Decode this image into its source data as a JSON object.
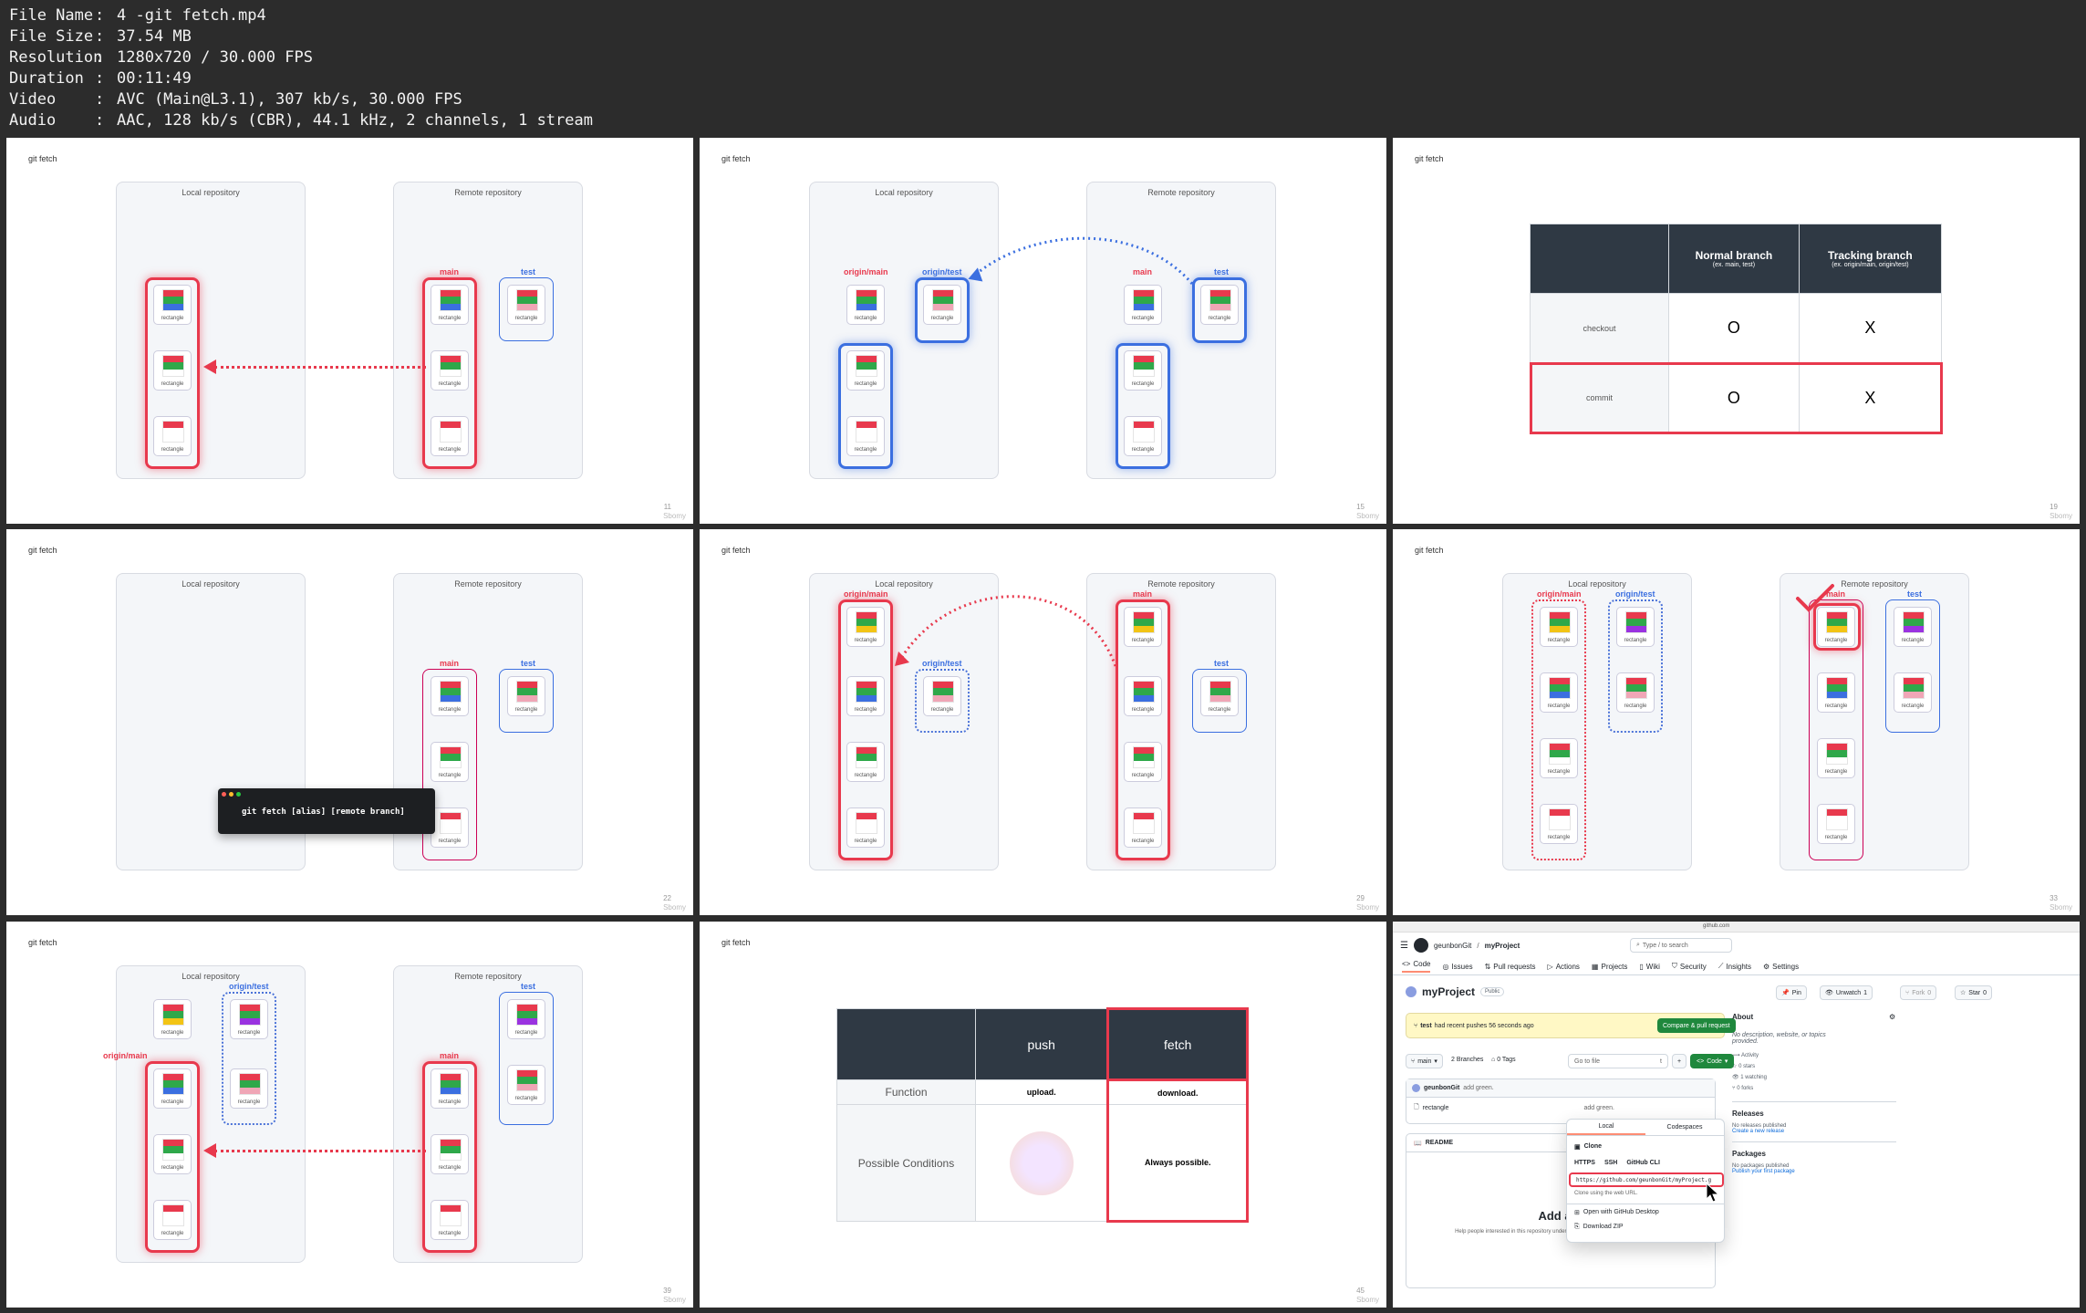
{
  "meta": {
    "rows": [
      {
        "key": "File Name",
        "value": "4 -git fetch.mp4"
      },
      {
        "key": "File Size",
        "value": "37.54 MB"
      },
      {
        "key": "Resolution",
        "value": "1280x720 / 30.000 FPS"
      },
      {
        "key": "Duration",
        "value": "00:11:49"
      },
      {
        "key": "Video",
        "value": "AVC (Main@L3.1), 307 kb/s, 30.000 FPS"
      },
      {
        "key": "Audio",
        "value": "AAC, 128 kb/s (CBR), 44.1 kHz, 2 channels, 1 stream"
      }
    ],
    "separator": ":"
  },
  "slide_title": "git fetch",
  "watermark": "Sbomy",
  "repo_labels": {
    "local": "Local repository",
    "remote": "Remote repository"
  },
  "branch_labels": {
    "main": "main",
    "test": "test",
    "origin_main": "origin/main",
    "origin_test": "origin/test"
  },
  "commit_label": "rectangle",
  "colors": {
    "red": "#e8394d",
    "blue": "#3b6fe0",
    "green": "#2fa84a",
    "yellow": "#f2c415",
    "pink": "#f0a6b6",
    "purple": "#9a33e0",
    "dark": "#2f3944"
  },
  "slide_numbers": [
    "11",
    "15",
    "19",
    "22",
    "29",
    "33",
    "39",
    "45"
  ],
  "table_tracking": {
    "headers": [
      "",
      "Normal branch",
      "Tracking branch"
    ],
    "subheaders": [
      "",
      "(ex. main, test)",
      "(ex. origin/main, origin/test)"
    ],
    "rows": [
      [
        "checkout",
        "O",
        "X"
      ],
      [
        "commit",
        "O",
        "X"
      ]
    ]
  },
  "terminal": {
    "command": "git fetch [alias] [remote branch]"
  },
  "table_pushfetch": {
    "headers": [
      "",
      "push",
      "fetch"
    ],
    "rows": [
      [
        "Function",
        "upload.",
        "download."
      ],
      [
        "Possible Conditions",
        "",
        "Always possible."
      ]
    ]
  },
  "github": {
    "url": "github.com",
    "owner": "geunbonGit",
    "slash": "/",
    "repo": "myProject",
    "search_placeholder": "Type / to search",
    "tabs": [
      "Code",
      "Issues",
      "Pull requests",
      "Actions",
      "Projects",
      "Wiki",
      "Security",
      "Insights",
      "Settings"
    ],
    "visibility": "Public",
    "pin": "Pin",
    "unwatch": "Unwatch",
    "unwatch_count": "1",
    "fork": "Fork",
    "fork_count": "0",
    "star": "Star",
    "star_count": "0",
    "banner_branch": "test",
    "banner_text": "had recent pushes 56 seconds ago",
    "compare_button": "Compare & pull request",
    "branch": "main",
    "branches": "2 Branches",
    "tags": "0 Tags",
    "go_to_file": "Go to file",
    "go_to_file_key": "t",
    "add": "+",
    "code_button": "Code",
    "commit_author": "geunbonGit",
    "commit_msg": "add green.",
    "file_name": "rectangle",
    "file_commit": "add green.",
    "readme": "README",
    "readme_heading": "Add a R",
    "readme_sub": "Help people interested in this repository understand your project by adding a README.",
    "dropdown": {
      "tab_local": "Local",
      "tab_codespaces": "Codespaces",
      "clone": "Clone",
      "protocols": [
        "HTTPS",
        "SSH",
        "GitHub CLI"
      ],
      "clone_url": "https://github.com/geunbonGit/myProject.g",
      "clone_hint": "Clone using the web URL.",
      "open_desktop": "Open with GitHub Desktop",
      "download_zip": "Download ZIP"
    },
    "about": {
      "title": "About",
      "desc": "No description, website, or topics provided.",
      "stats": [
        "Activity",
        "0 stars",
        "1 watching",
        "0 forks"
      ]
    },
    "releases": {
      "title": "Releases",
      "none": "No releases published",
      "link": "Create a new release"
    },
    "packages": {
      "title": "Packages",
      "none": "No packages published",
      "link": "Publish your first package"
    }
  }
}
